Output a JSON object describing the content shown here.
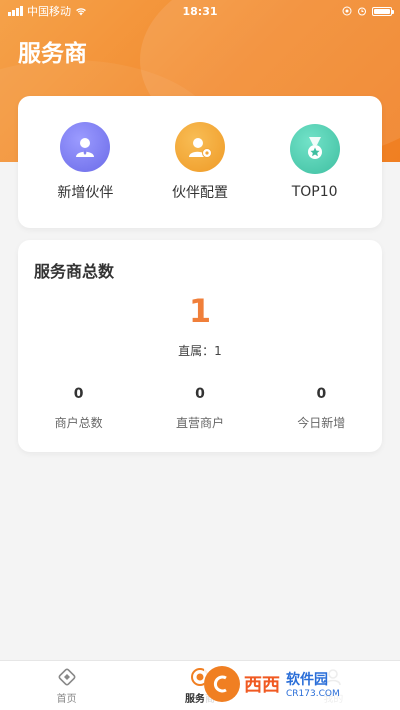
{
  "status_bar": {
    "carrier": "中国移动",
    "time": "18:31"
  },
  "header": {
    "title": "服务商",
    "color_start": "#f5a24a",
    "color_end": "#f07f22"
  },
  "quick_actions": [
    {
      "label": "新增伙伴",
      "icon": "user-plus-icon",
      "color": "#7f7ff0"
    },
    {
      "label": "伙伴配置",
      "icon": "user-settings-icon",
      "color": "#f3a63a"
    },
    {
      "label": "TOP10",
      "icon": "medal-icon",
      "color": "#4fcfb3"
    }
  ],
  "stats": {
    "title": "服务商总数",
    "total": "1",
    "direct": "直属：1",
    "items": [
      {
        "value": "0",
        "label": "商户总数"
      },
      {
        "value": "0",
        "label": "直营商户"
      },
      {
        "value": "0",
        "label": "今日新增"
      }
    ],
    "accent_color": "#f07f3a"
  },
  "tab_bar": {
    "tabs": [
      {
        "label": "首页",
        "icon": "home-icon",
        "active": false
      },
      {
        "label": "服务商",
        "icon": "service-provider-icon",
        "active": true
      },
      {
        "label": "我的",
        "icon": "profile-icon",
        "active": false
      }
    ]
  },
  "watermark": {
    "text": "西西",
    "brand": "软件园",
    "domain": "CR173.COM"
  }
}
